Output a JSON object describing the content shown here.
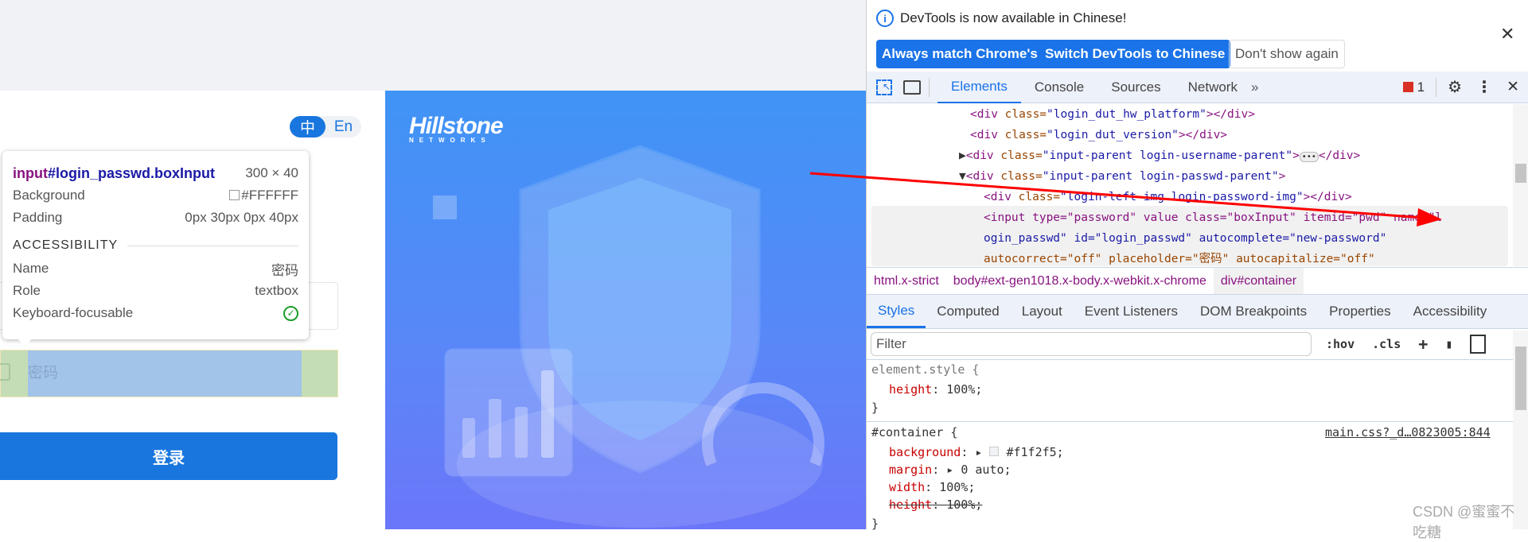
{
  "login": {
    "lang_zh": "中",
    "lang_en": "En",
    "password_placeholder": "密码",
    "login_button": "登录",
    "brand": "Hillstone",
    "brand_sub": "NETWORKS"
  },
  "tooltip": {
    "tag": "input",
    "selector": "#login_passwd.boxInput",
    "size": "300 × 40",
    "background_label": "Background",
    "background_value": "#FFFFFF",
    "padding_label": "Padding",
    "padding_value": "0px 30px 0px 40px",
    "accessibility": "ACCESSIBILITY",
    "name_label": "Name",
    "name_value": "密码",
    "role_label": "Role",
    "role_value": "textbox",
    "focus_label": "Keyboard-focusable"
  },
  "devtools": {
    "notice": "DevTools is now available in Chinese!",
    "btn_match": "Always match Chrome's language",
    "btn_switch": "Switch DevTools to Chinese",
    "btn_dont": "Don't show again",
    "tabs": [
      "Elements",
      "Console",
      "Sources",
      "Network"
    ],
    "error_count": "1",
    "dom": {
      "l1": {
        "tag": "<div ",
        "attr": "class=",
        "val": "\"login_dut_hw_platform\"",
        "end": "></div>"
      },
      "l2": {
        "tag": "<div ",
        "attr": "class=",
        "val": "\"login_dut_version\"",
        "end": "></div>"
      },
      "l3": {
        "tag": "<div ",
        "attr": "class=",
        "val": "\"input-parent login-username-parent\"",
        "end": ">",
        "end2": "</div>"
      },
      "l4": {
        "tag": "<div ",
        "attr": "class=",
        "val": "\"input-parent login-passwd-parent\"",
        "end": ">"
      },
      "l5": {
        "tag": "<div ",
        "attr": "class=",
        "val": "\"login-left-img login-password-img\"",
        "end": "></div>"
      },
      "l6": "<input type=\"password\" value class=\"boxInput\" itemid=\"pwd\" name=\"l",
      "l7": "ogin_passwd\" id=\"login_passwd\" autocomplete=\"new-password\"",
      "l8": "autocorrect=\"off\" placeholder=\"密码\" autocapitalize=\"off\""
    },
    "breadcrumbs": [
      "html.x-strict",
      "body#ext-gen1018.x-body.x-webkit.x-chrome",
      "div#container"
    ],
    "style_tabs": [
      "Styles",
      "Computed",
      "Layout",
      "Event Listeners",
      "DOM Breakpoints",
      "Properties",
      "Accessibility"
    ],
    "filter_placeholder": "Filter",
    "hov": ":hov",
    "cls": ".cls",
    "rules": {
      "r1_sel": "element.style {",
      "r1_p1": "height",
      "r1_v1": "100%;",
      "close": "}",
      "r2_sel": "#container {",
      "r2_src": "main.css?_d…0823005:844",
      "r2_p1": "background",
      "r2_v1": "#f1f2f5;",
      "r2_p2": "margin",
      "r2_v2": "0 auto;",
      "r2_p3": "width",
      "r2_v3": "100%;",
      "r2_p4": "height",
      "r2_v4": "100%;"
    }
  },
  "watermark": "CSDN @蜜蜜不吃糖",
  "colors": {
    "accent": "#1a73e8",
    "login_blue": "#1976de",
    "page_bg": "#f1f2f5",
    "annotation_arrow": "#ff0000"
  }
}
